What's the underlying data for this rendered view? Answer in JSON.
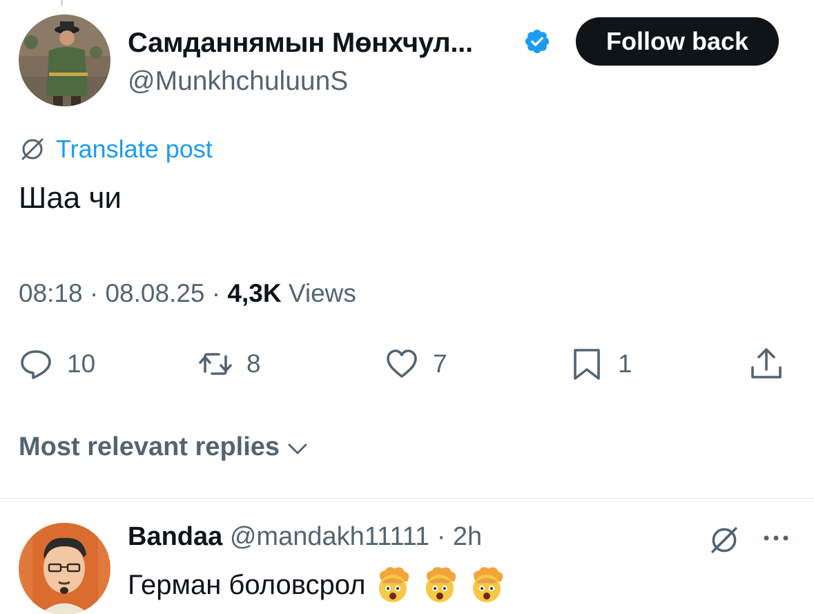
{
  "post": {
    "display_name": "Самданнямын Мөнхчул...",
    "handle": "@MunkhchuluunS",
    "follow_label": "Follow back",
    "translate_label": "Translate post",
    "text": "Шаа чи",
    "time": "08:18",
    "date": "08.08.25",
    "views_count": "4,3K",
    "views_label": "Views",
    "sep": "·"
  },
  "actions": {
    "replies": "10",
    "reposts": "8",
    "likes": "7",
    "bookmarks": "1"
  },
  "sort_label": "Most relevant replies",
  "reply": {
    "name": "Bandaa",
    "handle": "@mandakh11111",
    "sep": "·",
    "time": "2h",
    "text": "Герман боловсрол"
  },
  "colors": {
    "accent": "#1d9bf0",
    "secondary_text": "#536471",
    "primary_text": "#0f1419",
    "follow_bg": "#0f1419"
  },
  "icons": [
    "verified-badge-icon",
    "translate-icon",
    "reply-icon",
    "repost-icon",
    "like-icon",
    "bookmark-icon",
    "share-icon",
    "chevron-down-icon",
    "more-icon",
    "exploding-head-emoji"
  ]
}
